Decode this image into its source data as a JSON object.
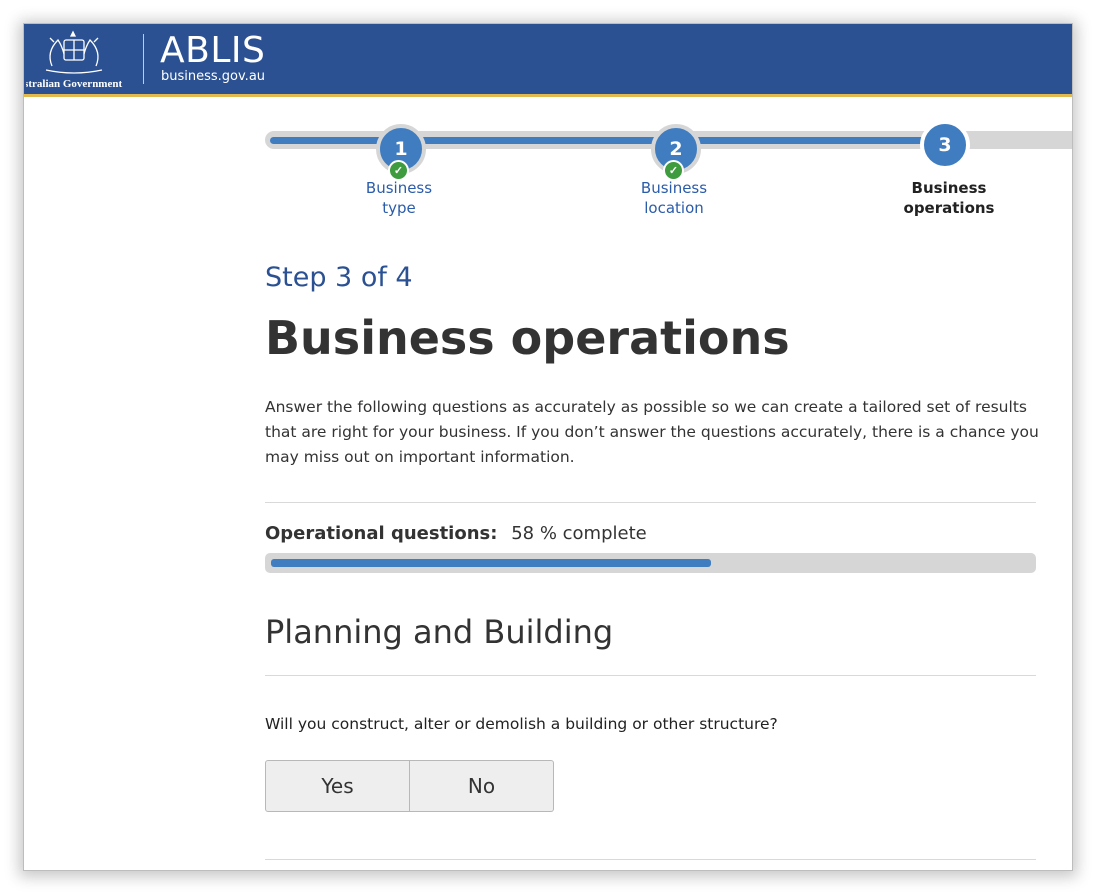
{
  "header": {
    "government": "Australian Government",
    "title": "ABLIS",
    "subtitle": "business.gov.au"
  },
  "stepper": {
    "steps": [
      {
        "number": "1",
        "label_line1": "Business",
        "label_line2": "type",
        "status": "complete"
      },
      {
        "number": "2",
        "label_line1": "Business",
        "label_line2": "location",
        "status": "complete"
      },
      {
        "number": "3",
        "label_line1": "Business",
        "label_line2": "operations",
        "status": "current"
      }
    ]
  },
  "main": {
    "step_counter": "Step 3 of 4",
    "title": "Business operations",
    "intro": "Answer the following questions as accurately as possible so we can create a tailored set of results that are right for your business. If you don’t answer the questions accurately, there is a chance you may miss out on important information.",
    "progress": {
      "label": "Operational questions:",
      "value_text": "58 % complete",
      "percent": 58
    },
    "section_title": "Planning and Building",
    "question": "Will you construct, alter or demolish a building or other structure?",
    "options": {
      "yes": "Yes",
      "no": "No"
    }
  },
  "colors": {
    "header_bg": "#2b5192",
    "header_accent": "#e1b94f",
    "step_blue": "#3f7dc0",
    "check_green": "#3e9b3e"
  },
  "icons": {
    "crest": "coat-of-arms-icon",
    "check": "check-icon"
  }
}
